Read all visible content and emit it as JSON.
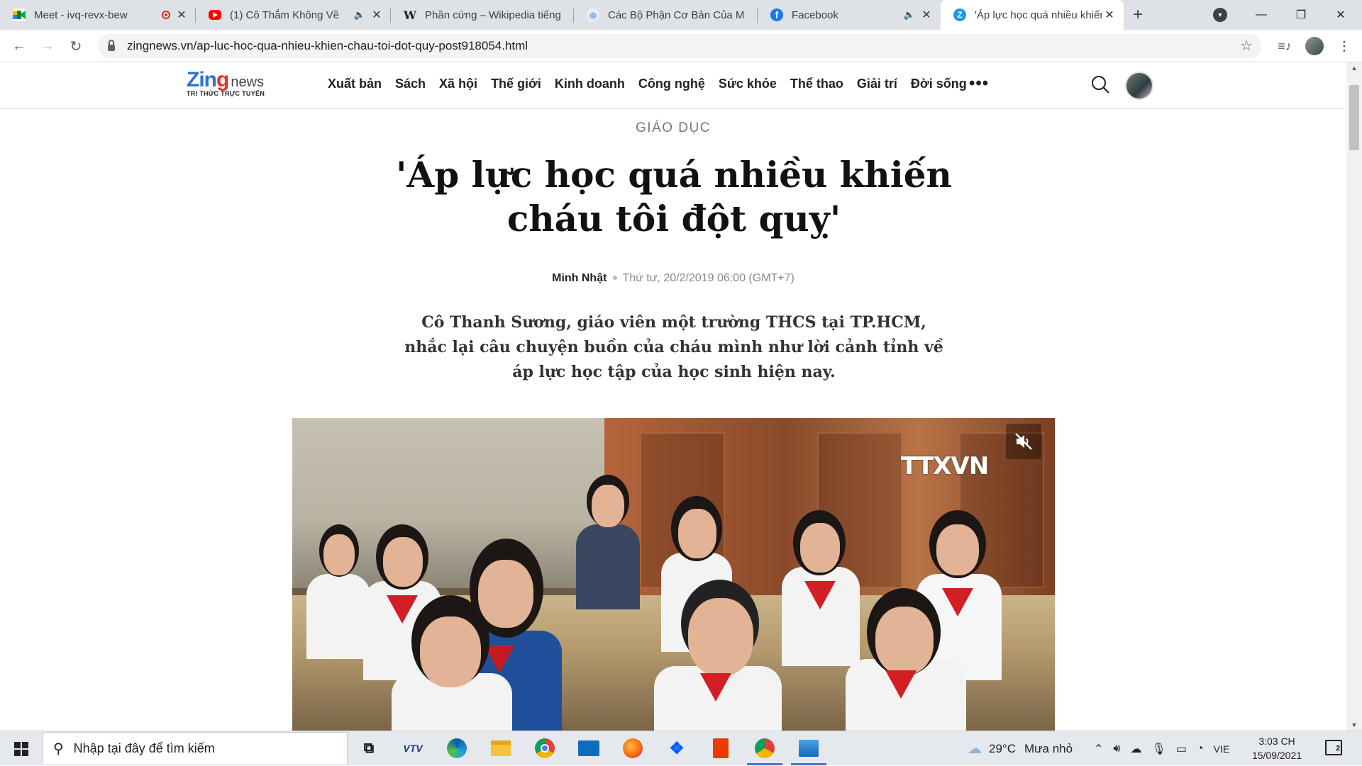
{
  "browser": {
    "tabs": [
      {
        "title": "Meet - ivq-revx-bew",
        "icon": "google-meet-icon",
        "indicator": "recording"
      },
      {
        "title": "(1) Cô Thắm Không Về",
        "icon": "youtube-icon",
        "indicator": "audio"
      },
      {
        "title": "Phần cứng – Wikipedia tiếng",
        "icon": "wikipedia-icon",
        "indicator": ""
      },
      {
        "title": "Các Bộ Phận Cơ Bản Của M",
        "icon": "page-icon",
        "indicator": ""
      },
      {
        "title": "Facebook",
        "icon": "facebook-icon",
        "indicator": "audio"
      },
      {
        "title": "'Áp lực học quá nhiều khiến",
        "icon": "zing-icon",
        "indicator": "",
        "active": true
      }
    ],
    "address": "zingnews.vn/ap-luc-hoc-qua-nhieu-khien-chau-toi-dot-quy-post918054.html"
  },
  "site": {
    "logo": {
      "zing_part1": "Zin",
      "zing_part2": "g",
      "news": "news",
      "tagline": "TRI THỨC TRỰC TUYẾN"
    },
    "nav": [
      "Xuất bản",
      "Sách",
      "Xã hội",
      "Thế giới",
      "Kinh doanh",
      "Công nghệ",
      "Sức khỏe",
      "Thể thao",
      "Giải trí",
      "Đời sống"
    ],
    "more": "•••"
  },
  "article": {
    "category": "GIÁO DỤC",
    "title": "'Áp lực học quá nhiều khiến cháu tôi đột quỵ'",
    "author": "Minh Nhật",
    "date": "Thứ tư, 20/2/2019 06:00 (GMT+7)",
    "sapo": "Cô Thanh Sương, giáo viên một trường THCS tại TP.HCM, nhắc lại câu chuyện buồn của cháu mình như lời cảnh tỉnh về áp lực học tập của học sinh hiện nay.",
    "video": {
      "watermark": "TTXVN",
      "muted": true
    }
  },
  "taskbar": {
    "search_placeholder": "Nhập tại đây để tìm kiếm",
    "apps": [
      "task-view",
      "vtv",
      "edge",
      "file-explorer",
      "chrome",
      "mail",
      "firefox",
      "dropbox",
      "office",
      "chrome-profile",
      "photos"
    ],
    "weather": {
      "temp": "29°C",
      "desc": "Mưa nhỏ"
    },
    "lang": "VIE",
    "time": "3:03 CH",
    "date": "15/09/2021",
    "notifications": "2"
  }
}
